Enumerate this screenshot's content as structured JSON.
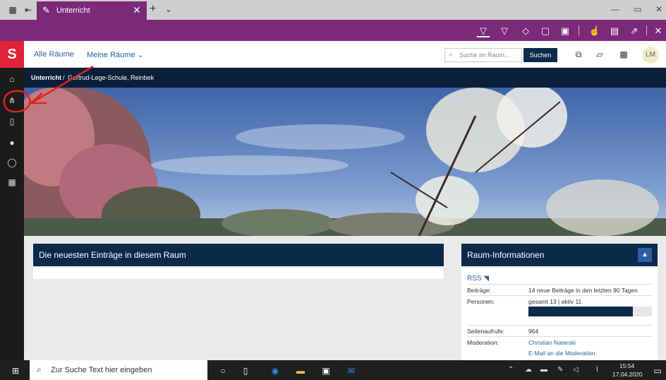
{
  "browser": {
    "tab_title": "Unterricht",
    "tab_close": "✕",
    "new_tab": "+",
    "tab_menu": "⌄",
    "window_minimize": "—",
    "window_restore": "▭",
    "window_close": "✕"
  },
  "ink_toolbar": {
    "icons": [
      "ballpoint-pen-icon",
      "highlighter-icon",
      "eraser-icon",
      "comment-icon",
      "clip-icon",
      "touch-writing-icon",
      "save-icon",
      "share-icon",
      "close-icon"
    ]
  },
  "rail": {
    "logo": "S",
    "items": [
      "home-icon",
      "org-chart-icon",
      "document-icon",
      "person-icon",
      "chat-icon",
      "calendar-icon"
    ]
  },
  "header": {
    "all_rooms": "Alle Räume",
    "my_rooms": "Meine Räume",
    "my_rooms_caret": "⌄",
    "search_placeholder": "Suche im Raum...",
    "search_button": "Suchen",
    "avatar": "LM"
  },
  "breadcrumb": {
    "current": "Unterricht",
    "sep": "/",
    "school": "Gertrud-Lege-Schule, Reinbek"
  },
  "main": {
    "latest_title": "Die neuesten Einträge in diesem Raum",
    "info_title": "Raum-Informationen",
    "collapse": "▲",
    "rss": "RSS",
    "info_rows": [
      {
        "label": "Beiträge:",
        "value": "14 neue Beiträge in den letzten 90 Tagen"
      },
      {
        "label": "Personen:",
        "value": "gesamt 13 | aktiv 11"
      },
      {
        "label": "Seitenaufrufe:",
        "value": "964"
      },
      {
        "label": "Moderation:",
        "value": "Christian Naterski"
      }
    ],
    "moderation_mail": "E-Mail an die Moderation",
    "active_ratio": 0.846
  },
  "taskbar": {
    "search_text": "Zur Suche Text hier eingeben",
    "time": "15:54",
    "date": "17.04.2020"
  },
  "colors": {
    "accent_purple": "#7a2a78",
    "navy": "#0b2a4a",
    "brand_red": "#e0223a"
  }
}
